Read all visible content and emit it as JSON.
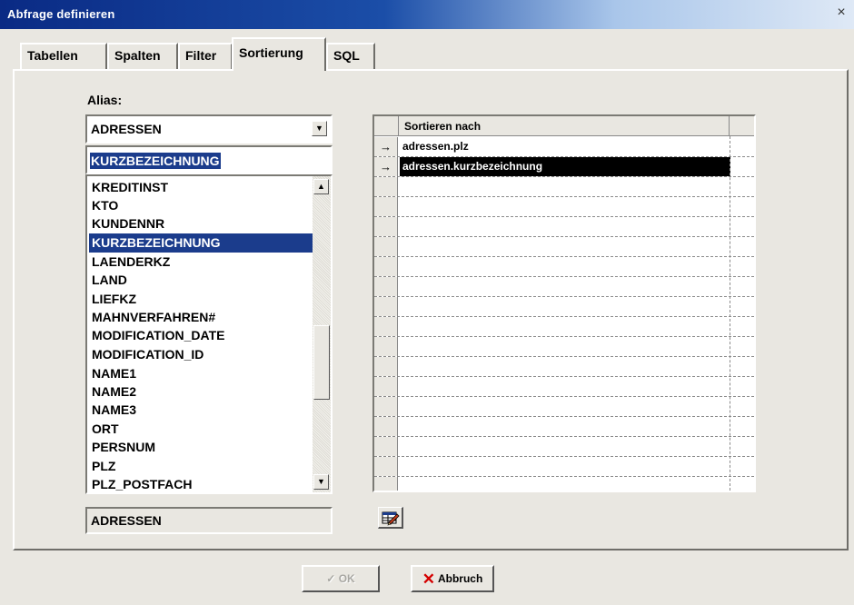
{
  "window": {
    "title": "Abfrage definieren",
    "close_glyph": "×"
  },
  "tabs": [
    {
      "label": "Tabellen"
    },
    {
      "label": "Spalten"
    },
    {
      "label": "Filter"
    },
    {
      "label": "Sortierung",
      "active": true
    },
    {
      "label": "SQL"
    }
  ],
  "alias": {
    "label": "Alias:",
    "combo_value": "ADRESSEN",
    "field_value": "KURZBEZEICHNUNG",
    "readonly_value": "ADRESSEN"
  },
  "columns_list": {
    "items": [
      "KREDITINST",
      "KTO",
      "KUNDENNR",
      "KURZBEZEICHNUNG",
      "LAENDERKZ",
      "LAND",
      "LIEFKZ",
      "MAHNVERFAHREN#",
      "MODIFICATION_DATE",
      "MODIFICATION_ID",
      "NAME1",
      "NAME2",
      "NAME3",
      "ORT",
      "PERSNUM",
      "PLZ",
      "PLZ_POSTFACH"
    ],
    "selected": "KURZBEZEICHNUNG"
  },
  "sort_grid": {
    "header": "Sortieren nach",
    "rows": [
      {
        "indicator": "→",
        "value": "adressen.plz"
      },
      {
        "indicator": "→",
        "value": "adressen.kurzbezeichnung",
        "active": true
      }
    ],
    "empty_rows": 14
  },
  "buttons": {
    "ok_label": "OK",
    "ok_check": "✓",
    "cancel_label": "Abbruch",
    "cancel_icon": "✕"
  },
  "icons": {
    "dropdown": "down-arrow-icon",
    "scroll_up": "up-arrow-icon",
    "scroll_down": "down-arrow-icon",
    "edit": "edit-table-icon"
  },
  "colors": {
    "selection": "#1b3c8c",
    "active_row": "#000000",
    "cancel_red": "#d40000"
  }
}
